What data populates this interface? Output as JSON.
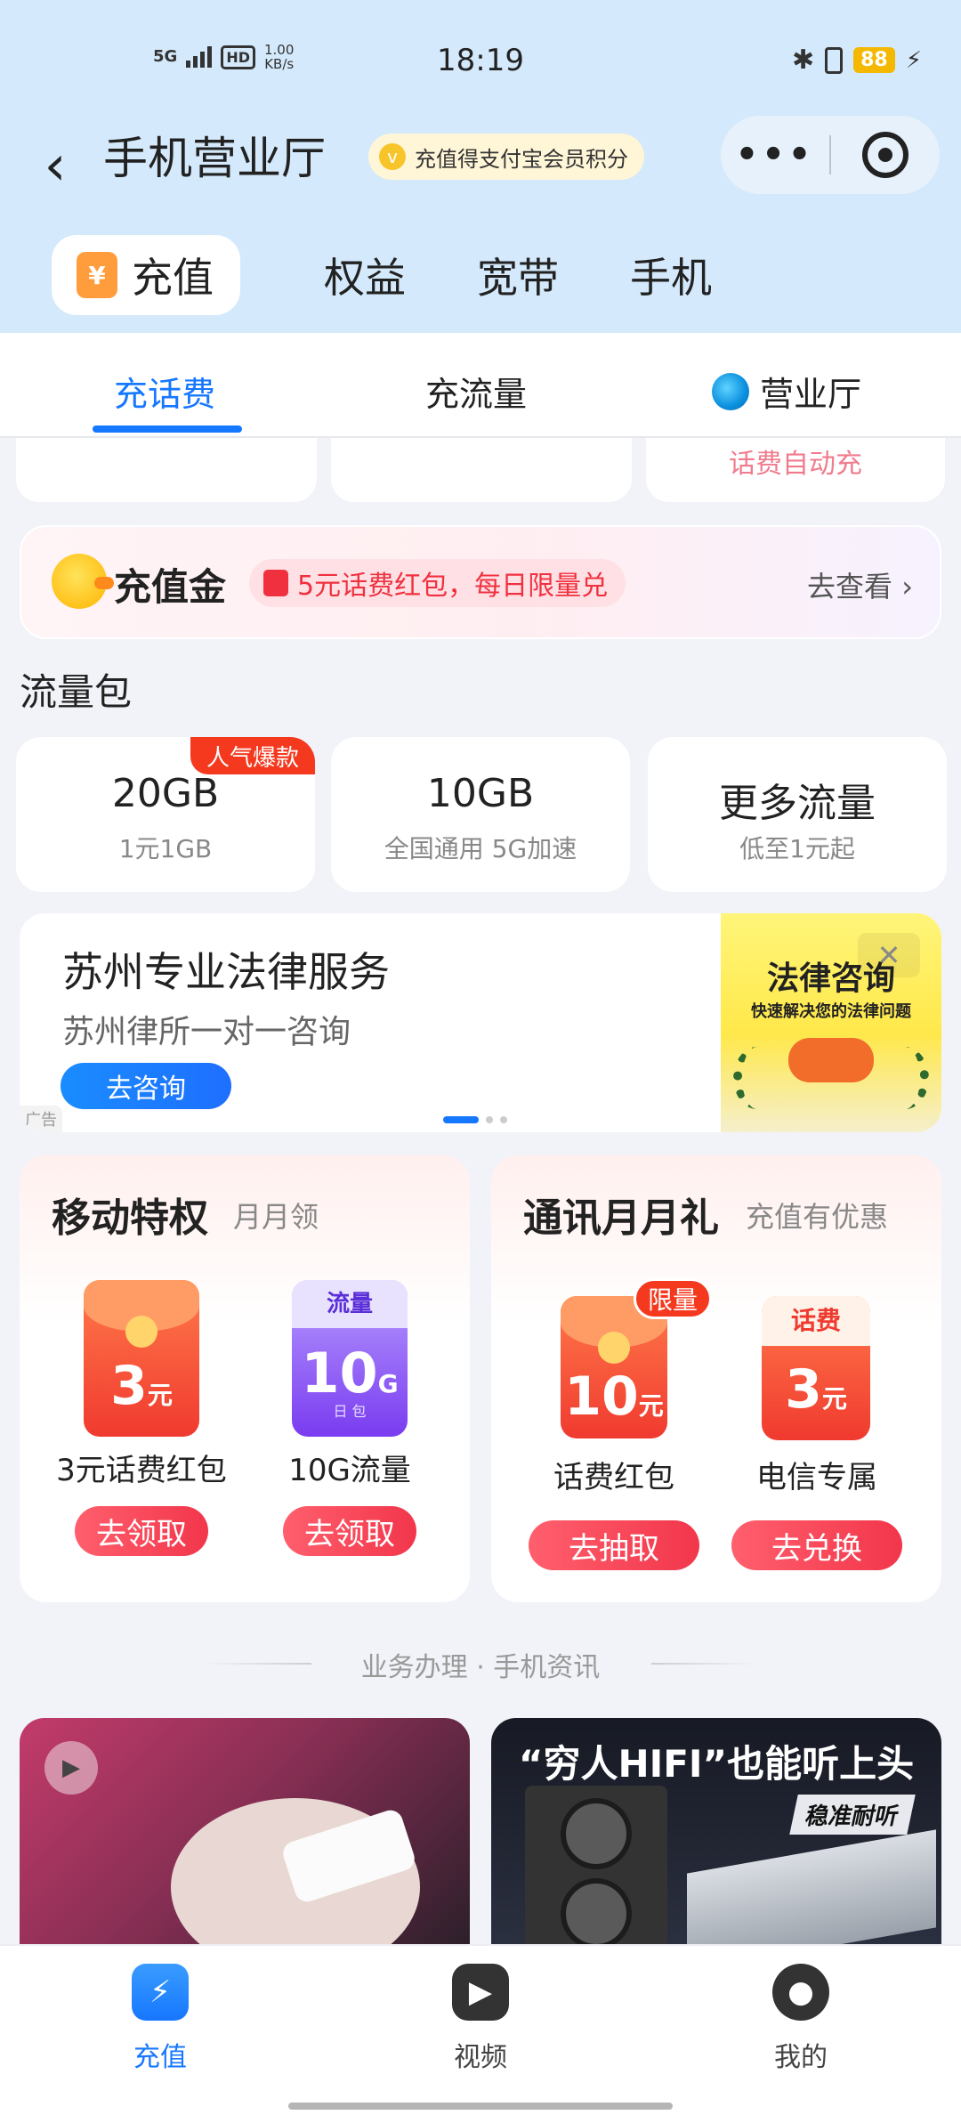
{
  "status_bar": {
    "network": "5G",
    "hd": "HD",
    "speed_value": "1.00",
    "speed_unit": "KB/s",
    "time": "18:19",
    "battery": "88"
  },
  "header": {
    "title": "手机营业厅",
    "promo": "充值得支付宝会员积分",
    "more": "•••"
  },
  "top_nav": [
    {
      "label": "充值",
      "icon": "yuan-icon"
    },
    {
      "label": "权益"
    },
    {
      "label": "宽带"
    },
    {
      "label": "手机"
    }
  ],
  "sub_tabs": [
    {
      "label": "充话费"
    },
    {
      "label": "充流量"
    },
    {
      "label": "营业厅",
      "icon": "china-mobile-logo"
    }
  ],
  "peek": {
    "auto_recharge": "话费自动充"
  },
  "recharge_gold": {
    "title": "充值金",
    "promo": "5元话费红包，每日限量兑",
    "link": "去查看 ›"
  },
  "data_section": {
    "title": "流量包",
    "items": [
      {
        "main": "20GB",
        "sub": "1元1GB",
        "badge": "人气爆款"
      },
      {
        "main": "10GB",
        "sub": "全国通用 5G加速"
      },
      {
        "main": "更多流量",
        "sub": "低至1元起"
      }
    ]
  },
  "ad": {
    "title": "苏州专业法律服务",
    "subtitle": "苏州律所一对一咨询",
    "button": "去咨询",
    "tag": "广告",
    "image_title": "法律咨询",
    "image_sub": "快速解决您的法律问题"
  },
  "mobile_privilege": {
    "title": "移动特权",
    "subtitle": "月月领",
    "gifts": [
      {
        "value": "3",
        "unit": "元",
        "name": "3元话费红包",
        "button": "去领取"
      },
      {
        "cap": "流量",
        "value": "10",
        "unit": "G",
        "day": "日 包",
        "name": "10G流量",
        "button": "去领取"
      }
    ]
  },
  "comm_gift": {
    "title": "通讯月月礼",
    "subtitle": "充值有优惠",
    "gifts": [
      {
        "value": "10",
        "unit": "元",
        "tag": "限量",
        "name": "话费红包",
        "button": "去抽取"
      },
      {
        "cap": "话费",
        "value": "3",
        "unit": "元",
        "name": "电信专属",
        "button": "去兑换"
      }
    ]
  },
  "divider": "业务办理 · 手机资讯",
  "feed": {
    "card2_headline": "“穷人HIFI”也能听上头",
    "card2_tag": "稳准耐听"
  },
  "bottom_nav": [
    {
      "label": "充值"
    },
    {
      "label": "视频"
    },
    {
      "label": "我的"
    }
  ],
  "colors": {
    "accent": "#1677ff",
    "red": "#f2364b",
    "header_bg": "#d4e9fb"
  }
}
